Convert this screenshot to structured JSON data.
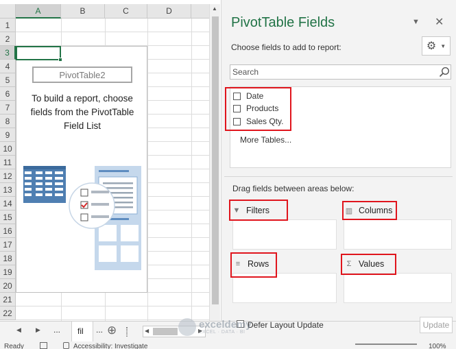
{
  "grid": {
    "columns": [
      "A",
      "B",
      "C",
      "D"
    ],
    "rows": [
      "1",
      "2",
      "3",
      "4",
      "5",
      "6",
      "7",
      "8",
      "9",
      "10",
      "11",
      "12",
      "13",
      "14",
      "15",
      "16",
      "17",
      "18",
      "19",
      "20",
      "21",
      "22"
    ],
    "selected_column": "A",
    "selected_row": "3"
  },
  "pivot_placeholder": {
    "name": "PivotTable2",
    "instructions": "To build a report, choose fields from the PivotTable Field List"
  },
  "sheet_tabs": {
    "prev": "◀",
    "next": "▶",
    "more": "...",
    "tab_label": "fil",
    "more_right": "...",
    "add": "⊕"
  },
  "status_bar": {
    "ready": "Ready",
    "accessibility": "Accessibility: Investigate",
    "zoom": "100%"
  },
  "pane": {
    "title": "PivotTable Fields",
    "choose_label": "Choose fields to add to report:",
    "search_placeholder": "Search",
    "fields": [
      {
        "label": "Date",
        "checked": false
      },
      {
        "label": "Products",
        "checked": false
      },
      {
        "label": "Sales Qty.",
        "checked": false
      }
    ],
    "more_tables": "More Tables...",
    "drag_label": "Drag fields between areas below:",
    "areas": {
      "filters": "Filters",
      "columns": "Columns",
      "rows": "Rows",
      "values": "Values"
    },
    "defer_label": "Defer Layout Update",
    "update_label": "Update"
  },
  "watermark": {
    "name": "exceldemy",
    "tagline": "EXCEL · DATA · BI"
  },
  "colors": {
    "excel_green": "#217346",
    "highlight_red": "#e0141c"
  }
}
